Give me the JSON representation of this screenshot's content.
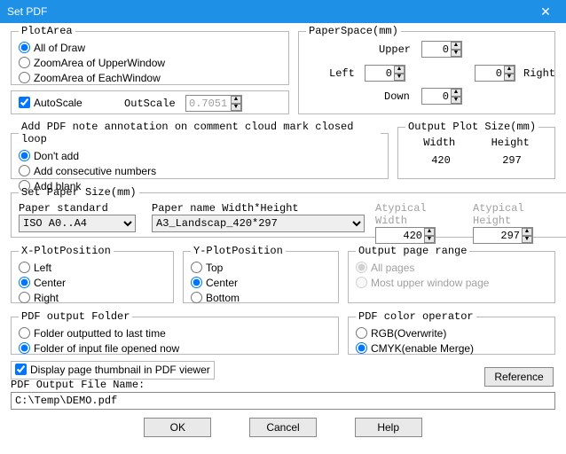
{
  "window": {
    "title": "Set PDF",
    "close": "✕"
  },
  "plotArea": {
    "legend": "PlotArea",
    "opt1": "All of Draw",
    "opt2": "ZoomArea of UpperWindow",
    "opt3": "ZoomArea of  EachWindow"
  },
  "autoscale": {
    "label": "AutoScale",
    "outscale_label": "OutScale",
    "outscale_value": "0.7051"
  },
  "paperSpace": {
    "legend": "PaperSpace(mm)",
    "upper": "Upper",
    "left": "Left",
    "right": "Right",
    "down": "Down",
    "upper_v": "0",
    "left_v": "0",
    "right_v": "0",
    "down_v": "0"
  },
  "noteAnno": {
    "legend": "Add PDF note annotation on comment cloud mark closed loop",
    "opt1": "Don't add",
    "opt2": "Add consecutive numbers",
    "opt3": "Add blank"
  },
  "outputPlot": {
    "legend": "Output Plot Size(mm)",
    "width_label": "Width",
    "height_label": "Height",
    "width_v": "420",
    "height_v": "297"
  },
  "setPaper": {
    "legend": "Set Paper Size(mm)",
    "std_label": "Paper standard",
    "name_label": "Paper name Width*Height",
    "atw_label": "Atypical Width",
    "ath_label": "Atypical Height",
    "std_val": "ISO A0..A4",
    "name_val": "A3_Landscap_420*297",
    "atw_val": "420",
    "ath_val": "297"
  },
  "xpos": {
    "legend": "X-PlotPosition",
    "opt1": "Left",
    "opt2": "Center",
    "opt3": "Right"
  },
  "ypos": {
    "legend": "Y-PlotPosition",
    "opt1": "Top",
    "opt2": "Center",
    "opt3": "Bottom"
  },
  "pageRange": {
    "legend": "Output page range",
    "opt1": "All pages",
    "opt2": "Most upper window page"
  },
  "outFolder": {
    "legend": "PDF output Folder",
    "opt1": "Folder outputted to last time",
    "opt2": "Folder of input file opened now"
  },
  "colorOp": {
    "legend": "PDF color operator",
    "opt1": "RGB(Overwrite)",
    "opt2": "CMYK(enable Merge)"
  },
  "thumb": {
    "label": "Display page thumbnail in PDF viewer"
  },
  "reference": "Reference",
  "output_file_label": "PDF Output File Name:",
  "output_file_value": "C:\\Temp\\DEMO.pdf",
  "buttons": {
    "ok": "OK",
    "cancel": "Cancel",
    "help": "Help"
  }
}
